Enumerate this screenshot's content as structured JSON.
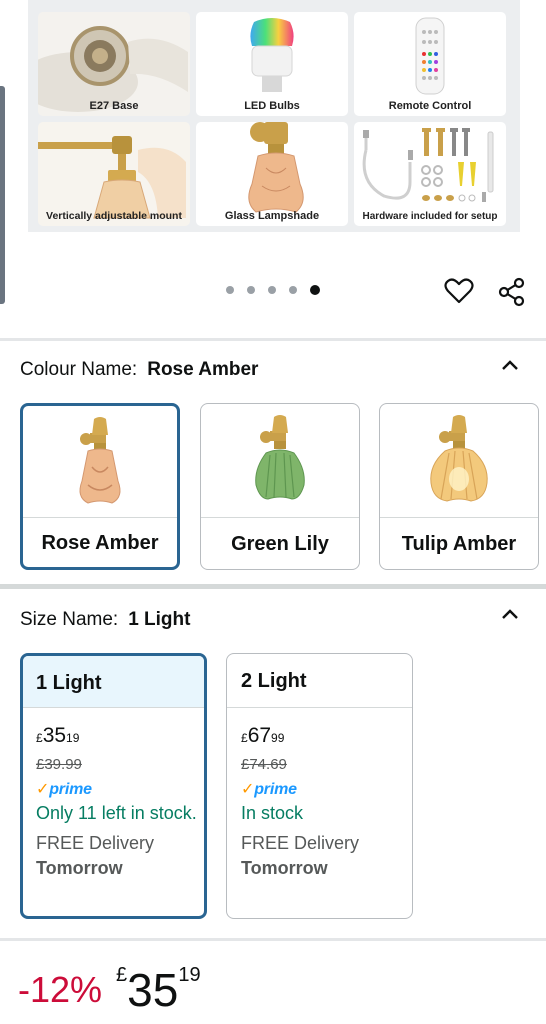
{
  "gallery": {
    "tiles": [
      {
        "caption": "E27 Base",
        "icon": "e27-socket-image"
      },
      {
        "caption": "LED Bulbs",
        "icon": "rgb-led-bulb-image"
      },
      {
        "caption": "Remote Control",
        "icon": "remote-control-image"
      },
      {
        "caption": "Vertically adjustable mount",
        "icon": "brass-mount-image"
      },
      {
        "caption": "Glass Lampshade",
        "icon": "glass-lampshade-image"
      },
      {
        "caption": "Hardware included for setup",
        "icon": "hardware-kit-image"
      }
    ],
    "active_dot": 5,
    "dot_count": 5
  },
  "actions": {
    "wishlist_icon": "heart-icon",
    "share_icon": "share-icon"
  },
  "colour": {
    "label": "Colour Name:",
    "selected": "Rose Amber",
    "options": [
      {
        "label": "Rose Amber",
        "selected": true,
        "color": "#e8a878"
      },
      {
        "label": "Green Lily",
        "selected": false,
        "color": "#7fb56a"
      },
      {
        "label": "Tulip Amber",
        "selected": false,
        "color": "#f0c070"
      }
    ]
  },
  "size": {
    "label": "Size Name:",
    "selected": "1 Light",
    "options": [
      {
        "label": "1 Light",
        "currency": "£",
        "price_whole": "35",
        "price_fraction": "19",
        "was_price": "£39.99",
        "prime_label": "prime",
        "stock": "Only 11 left in stock.",
        "delivery": "FREE Delivery",
        "delivery_day": "Tomorrow",
        "selected": true
      },
      {
        "label": "2 Light",
        "currency": "£",
        "price_whole": "67",
        "price_fraction": "99",
        "was_price": "£74.69",
        "prime_label": "prime",
        "stock": "In stock",
        "delivery": "FREE Delivery",
        "delivery_day": "Tomorrow",
        "selected": false
      }
    ]
  },
  "price": {
    "discount": "-12%",
    "currency": "£",
    "whole": "35",
    "fraction": "19"
  },
  "colors": {
    "accent_border": "#2a6592",
    "discount_red": "#cc0c39",
    "stock_green": "#067d62",
    "prime_blue": "#1a98ff"
  }
}
